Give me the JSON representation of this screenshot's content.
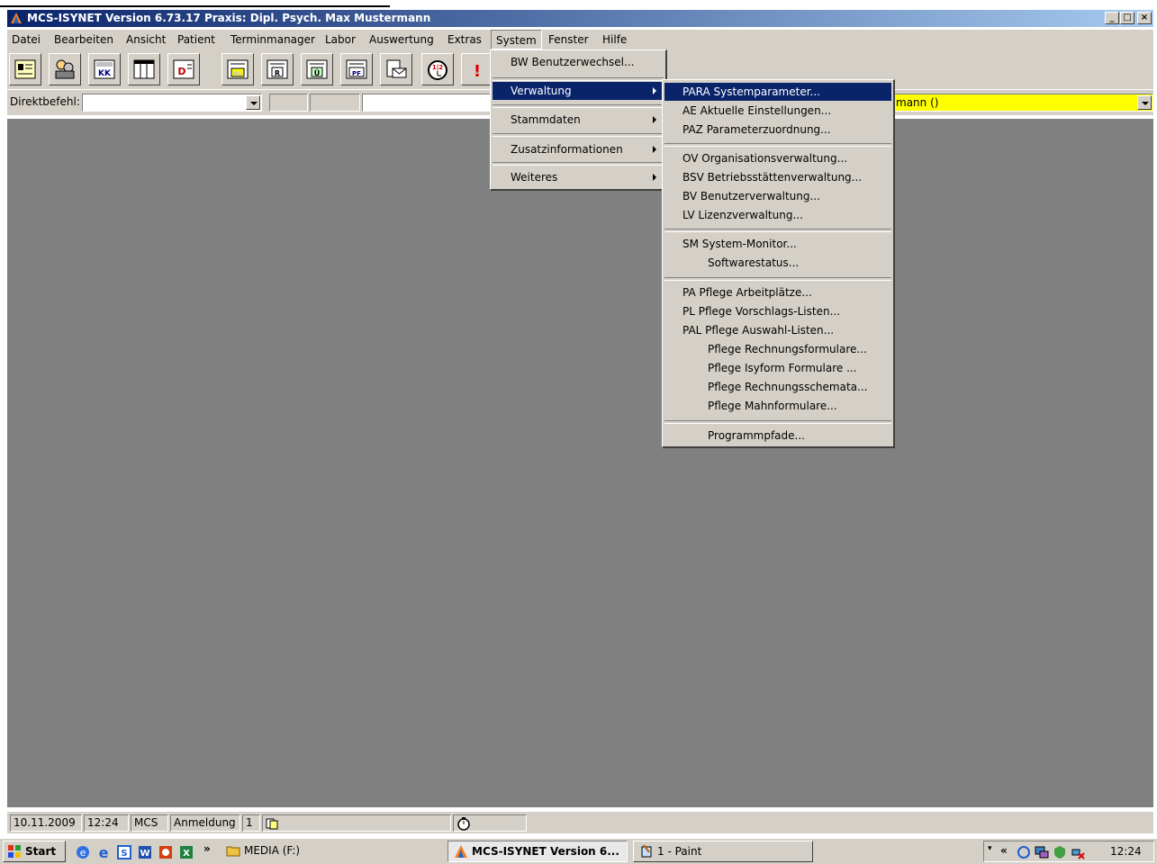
{
  "window": {
    "title": "MCS-ISYNET Version 6.73.17 Praxis: Dipl. Psych. Max Mustermann",
    "min": "_",
    "max": "□",
    "close": "×"
  },
  "menubar": {
    "items": [
      "Datei",
      "Bearbeiten",
      "Ansicht",
      "Patient",
      "Terminmanager",
      "Labor",
      "Auswertung",
      "Extras",
      "System",
      "Fenster",
      "Hilfe"
    ]
  },
  "toolbar": {
    "labels": [
      "KK",
      "D",
      "AU",
      "R",
      "Ü",
      "PF",
      "1|2",
      "!"
    ]
  },
  "cmdbar": {
    "label": "Direktbefehl:",
    "value": "",
    "patient_text": "mann ()"
  },
  "system_menu": {
    "items": [
      "BW  Benutzerwechsel...",
      "Verwaltung",
      "Stammdaten",
      "Zusatzinformationen",
      "Weiteres"
    ]
  },
  "verwaltung_submenu": {
    "items": [
      "PARA Systemparameter...",
      "AE   Aktuelle Einstellungen...",
      "PAZ  Parameterzuordnung...",
      "OV  Organisationsverwaltung...",
      "BSV Betriebsstättenverwaltung...",
      "BV   Benutzerverwaltung...",
      "LV   Lizenzverwaltung...",
      "SM  System-Monitor...",
      "Softwarestatus...",
      "PA   Pflege Arbeitplätze...",
      "PL   Pflege Vorschlags-Listen...",
      "PAL Pflege Auswahl-Listen...",
      "Pflege Rechnungsformulare...",
      "Pflege Isyform Formulare ...",
      "Pflege Rechnungsschemata...",
      "Pflege Mahnformulare...",
      "Programmpfade..."
    ]
  },
  "statusbar": {
    "date": "10.11.2009",
    "time": "12:24",
    "user": "MCS",
    "mode": "Anmeldung",
    "count": "1"
  },
  "taskbar": {
    "start": "Start",
    "chevron": "»",
    "media": "MEDIA (F:)",
    "mcs": "MCS-ISYNET Version 6...",
    "paint": "1 - Paint",
    "tray_chevron": "«",
    "clock": "12:24"
  },
  "colors": {
    "title_start": "#0a246a",
    "title_end": "#a6caf0",
    "workspace": "#808080",
    "chrome": "#d4d0c8",
    "highlight": "#0a246a",
    "patient_field": "#ffff00"
  }
}
